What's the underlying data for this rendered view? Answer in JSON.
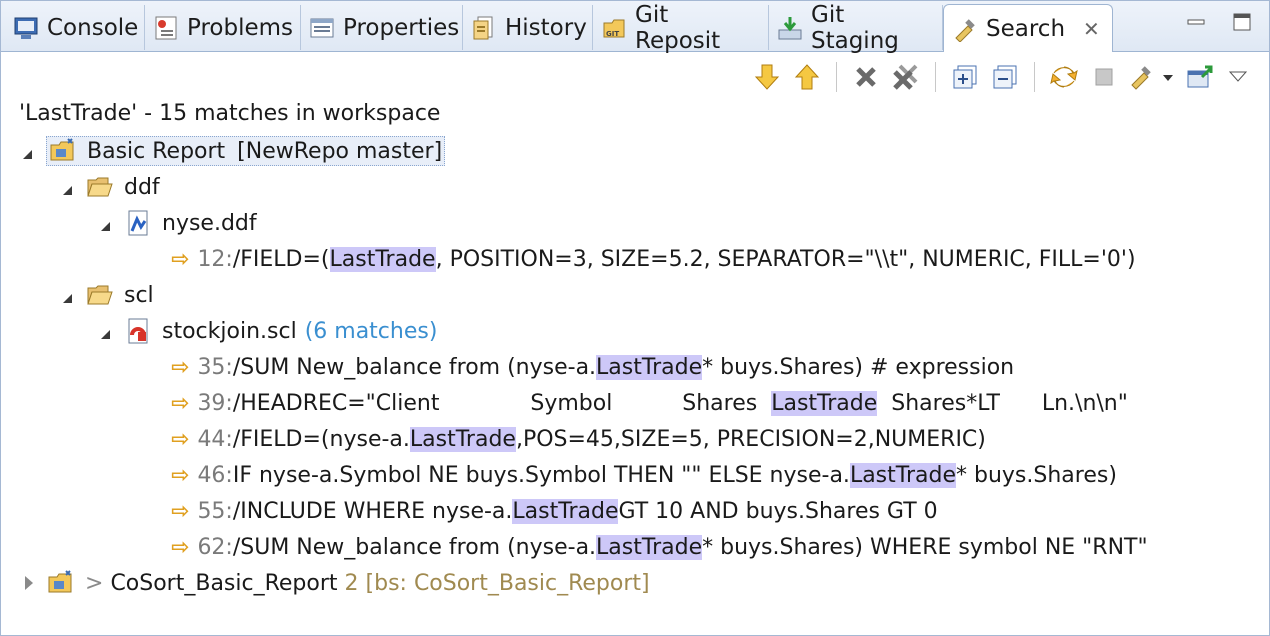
{
  "tabs": [
    {
      "label": "Console",
      "icon": "console-icon"
    },
    {
      "label": "Problems",
      "icon": "problems-icon"
    },
    {
      "label": "Properties",
      "icon": "properties-icon"
    },
    {
      "label": "History",
      "icon": "history-icon"
    },
    {
      "label": "Git Reposit",
      "icon": "git-repositories-icon"
    },
    {
      "label": "Git Staging",
      "icon": "git-staging-icon"
    },
    {
      "label": "Search",
      "icon": "search-flashlight-icon",
      "active": true
    }
  ],
  "tab_close_glyph": "✕",
  "toolbar": {
    "icons": [
      "next-match-icon",
      "previous-match-icon",
      "remove-match-icon",
      "remove-all-matches-icon",
      "expand-all-icon",
      "collapse-all-icon",
      "refresh-search-icon",
      "cancel-search-icon",
      "search-history-icon",
      "pin-view-icon"
    ]
  },
  "summary": "'LastTrade' - 15 matches in workspace",
  "tree": {
    "project1": {
      "name": "Basic Report",
      "repo": "[NewRepo master]"
    },
    "folder_ddf": "ddf",
    "file_nyse": "nyse.ddf",
    "match_ddf": {
      "line": "12: ",
      "pre": "/FIELD=(",
      "hit": "LastTrade",
      "post": ", POSITION=3, SIZE=5.2, SEPARATOR=\"\\\\t\", NUMERIC, FILL='0')"
    },
    "folder_scl": "scl",
    "file_scl": {
      "name": "stockjoin.scl",
      "count": "(6 matches)"
    },
    "matches_scl": [
      {
        "line": "35: ",
        "pre": "/SUM New_balance from (nyse-a.",
        "hit": "LastTrade",
        "post": " * buys.Shares)  # expression"
      },
      {
        "line": "39: ",
        "pre": "/HEADREC=\"Client             Symbol          Shares  ",
        "hit": "LastTrade",
        "post": "  Shares*LT      Ln.\\n\\n\""
      },
      {
        "line": "44: ",
        "pre": "/FIELD=(nyse-a.",
        "hit": "LastTrade",
        "post": ",POS=45,SIZE=5, PRECISION=2,NUMERIC)"
      },
      {
        "line": "46: ",
        "pre": "IF nyse-a.Symbol NE buys.Symbol THEN \"\" ELSE nyse-a.",
        "hit": "LastTrade",
        "post": " * buys.Shares)"
      },
      {
        "line": "55: ",
        "pre": "/INCLUDE WHERE nyse-a.",
        "hit": "LastTrade",
        "post": " GT 10 AND buys.Shares GT 0"
      },
      {
        "line": "62: ",
        "pre": "/SUM New_balance from (nyse-a.",
        "hit": "LastTrade",
        "post": " * buys.Shares) WHERE symbol NE \"RNT\""
      }
    ],
    "project2": {
      "prefix": "> ",
      "name": "CoSort_Basic_Report",
      "count": " 2",
      "repo": " [bs: CoSort_Basic_Report]"
    }
  },
  "colors": {
    "highlight": "#cdc8f8",
    "arrow": "#e0a020",
    "count": "#3a8fd0",
    "tabbar": "#dfe8f4"
  }
}
